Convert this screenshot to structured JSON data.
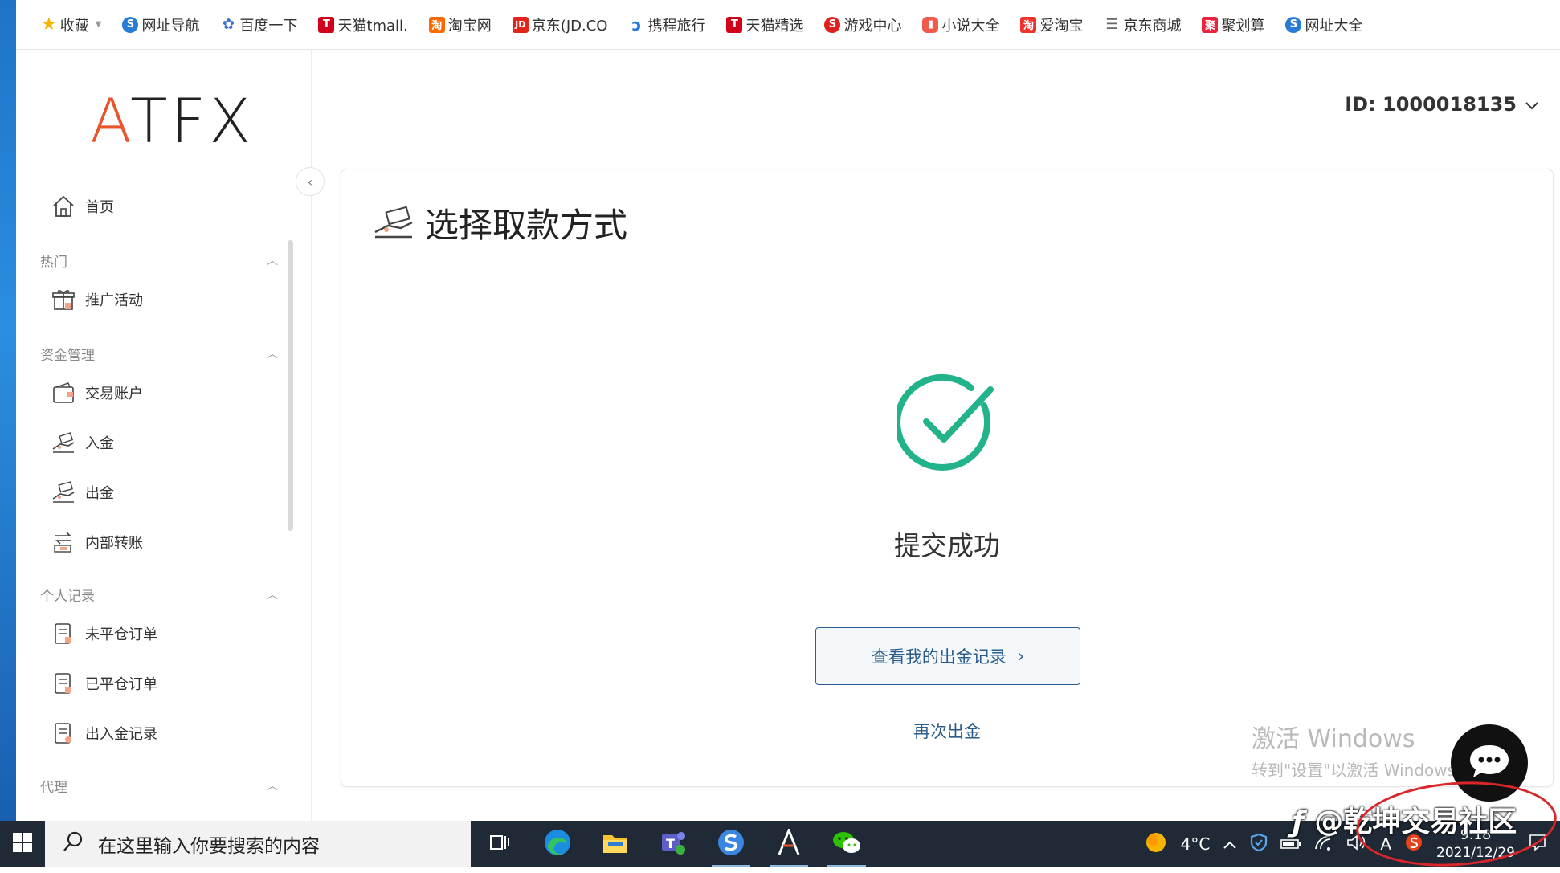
{
  "bookmarks": {
    "favorites_label": "收藏",
    "items": [
      {
        "label": "网址导航",
        "icon": "browser-icon",
        "color": "#2a7bd4"
      },
      {
        "label": "百度一下",
        "icon": "baidu-paw-icon",
        "color": "#3a6fd8"
      },
      {
        "label": "天猫tmall.",
        "icon": "tmall-icon",
        "color": "#d0021b"
      },
      {
        "label": "淘宝网",
        "icon": "taobao-icon",
        "color": "#ff6a00"
      },
      {
        "label": "京东(JD.CO",
        "icon": "jd-icon",
        "color": "#e1251b"
      },
      {
        "label": "携程旅行",
        "icon": "ctrip-icon",
        "color": "#2577e3"
      },
      {
        "label": "天猫精选",
        "icon": "tmall-icon",
        "color": "#d0021b"
      },
      {
        "label": "游戏中心",
        "icon": "game-icon",
        "color": "#e0201c"
      },
      {
        "label": "小说大全",
        "icon": "novel-icon",
        "color": "#f05a4a"
      },
      {
        "label": "爱淘宝",
        "icon": "aitaobao-icon",
        "color": "#f0322d"
      },
      {
        "label": "京东商城",
        "icon": "document-icon",
        "color": "#666666"
      },
      {
        "label": "聚划算",
        "icon": "juhuasuan-icon",
        "color": "#e9243c"
      },
      {
        "label": "网址大全",
        "icon": "browser-icon",
        "color": "#2a7bd4"
      }
    ]
  },
  "sidebar": {
    "logo": {
      "a": "A",
      "rest": "TFX"
    },
    "home": "首页",
    "groups": {
      "hot": "热门",
      "funds": "资金管理",
      "records": "个人记录",
      "agent": "代理"
    },
    "items": {
      "promo": "推广活动",
      "trading_account": "交易账户",
      "deposit": "入金",
      "withdraw": "出金",
      "transfer": "内部转账",
      "open_orders": "未平仓订单",
      "closed_orders": "已平仓订单",
      "fund_records": "出入金记录"
    }
  },
  "header": {
    "user_id": "ID: 1000018135"
  },
  "main": {
    "title": "选择取款方式",
    "success_text": "提交成功",
    "record_button": "查看我的出金记录",
    "again_link": "再次出金"
  },
  "watermark": {
    "activate_title": "激活 Windows",
    "activate_sub": "转到\"设置\"以激活 Windows。",
    "social": "@乾坤交易社区"
  },
  "taskbar": {
    "search_placeholder": "在这里输入你要搜索的内容",
    "temperature": "4°C",
    "time": "9:18",
    "date": "2021/12/29",
    "ime": "A"
  },
  "colors": {
    "brand_accent": "#e8542b",
    "success_green": "#22b38a",
    "link_blue": "#2b5d8c",
    "taskbar": "#1f2a36"
  }
}
